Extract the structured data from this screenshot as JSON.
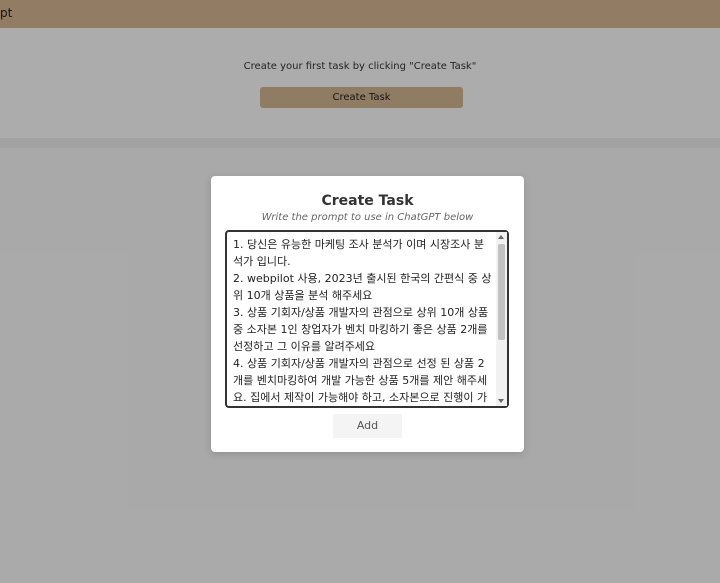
{
  "app": {
    "title_fragment": "pt"
  },
  "panel": {
    "message": "Create your first task by clicking \"Create Task\"",
    "create_button_label": "Create Task"
  },
  "modal": {
    "title": "Create Task",
    "subtitle": "Write the prompt to use in ChatGPT below",
    "prompt_text": "1. 당신은 유능한 마케팅 조사 분석가 이며 시장조사 분석가 입니다.\n2. webpilot 사용, 2023년 출시된 한국의 간편식 중 상위 10개 상품을 분석 해주세요\n3. 상품 기회자/상품 개발자의 관점으로 상위 10개 상품 중 소자본 1인 창업자가 벤치 마킹하기 좋은 상품 2개를 선정하고 그 이유를 알려주세요\n4. 상품 기회자/상품 개발자의 관점으로 선정 된 상품 2개를 벤치마킹하여 개발 가능한 상품 5개를 제안 해주세요. 집에서 제작이 가능해야 하고, 소자본으로 진행이 가능한 상품이어야 합니다.",
    "add_button_label": "Add"
  },
  "colors": {
    "topbar": "#d2b28f",
    "create_button": "#cfb08e"
  }
}
